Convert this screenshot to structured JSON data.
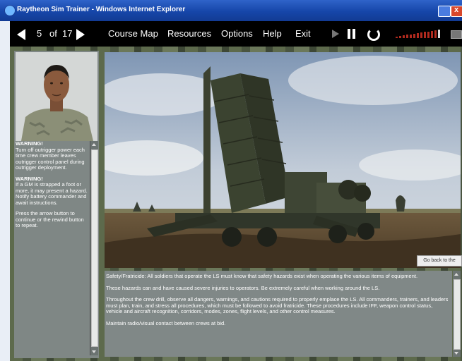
{
  "window": {
    "title": "Raytheon Sim Trainer - Windows Internet Explorer"
  },
  "nav": {
    "current_page": "5",
    "of_label": "of",
    "total_pages": "17",
    "menu": [
      "Course Map",
      "Resources",
      "Options",
      "Help",
      "Exit"
    ]
  },
  "sidebar": {
    "warning1_title": "WARNING!",
    "warning1_body": "Turn off outrigger power each time crew member leaves outrigger control panel during outrigger deployment.",
    "warning2_title": "WARNING!",
    "warning2_body": "If a GM is strapped a foot or more, it may present a hazard. Notify battery commander and await instructions.",
    "instruction": "Press the arrow button to continue or the rewind button to repeat."
  },
  "photo": {
    "go_back_label": "Go back to the"
  },
  "content": {
    "p1": "Safety/Fratricide: All soldiers that operate the LS must know that safety hazards exist when operating the various items of equipment.",
    "p2": "These hazards can and have caused severe injuries to operators. Be extremely careful when working around the LS.",
    "p3": "Throughout the crew drill, observe all dangers, warnings, and cautions required to properly emplace the LS. All commanders, trainers, and leaders must plan, train, and stress all procedures, which must be followed to avoid fratricide. These procedures include IFF, weapon control status, vehicle and aircraft recognition, corridors, modes, zones, flight levels, and other control measures.",
    "p4": "Maintain radio/visual contact between crews at bid."
  },
  "colors": {
    "titlebar": "#1646a9",
    "volume_bar": "#b02a1e",
    "panel_gray": "#808887"
  },
  "icons": [
    "previous-arrow-icon",
    "next-arrow-icon",
    "play-icon",
    "pause-icon",
    "replay-icon",
    "volume-icon",
    "mute-icon"
  ]
}
